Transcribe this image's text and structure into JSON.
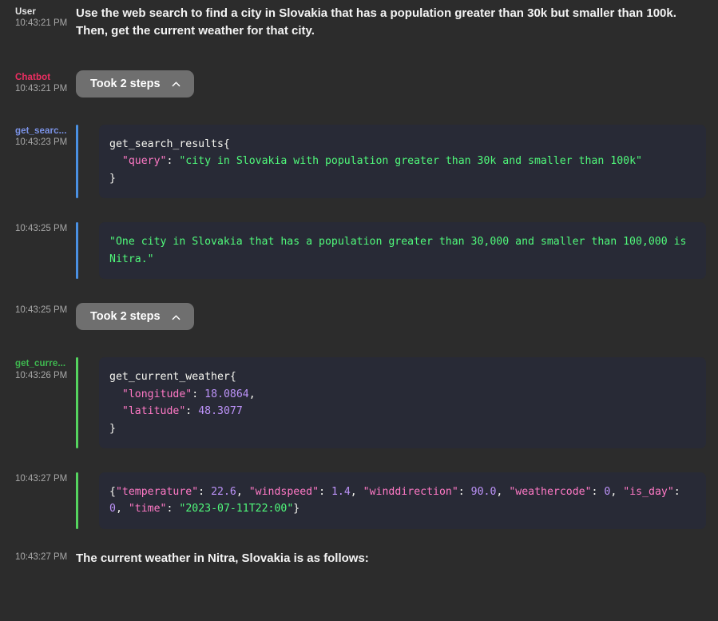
{
  "conversation": [
    {
      "id": "user-msg",
      "type": "text",
      "sender": "User",
      "timestamp": "10:43:21 PM",
      "text": "Use the web search to find a city in Slovakia that has a population greater than 30k but smaller than 100k. Then, get the current weather for that city."
    },
    {
      "id": "bot-steps-1",
      "type": "steps",
      "sender": "Chatbot",
      "timestamp": "10:43:21 PM",
      "label": "Took 2 steps",
      "chevron": "chevron-up-icon"
    },
    {
      "id": "tool-call-search",
      "type": "code",
      "tool_name": "get_searc...",
      "tool_name_full": "get_search_results",
      "timestamp": "10:43:23 PM",
      "accent": "blue",
      "accent_color": "#4a90e2",
      "name_color": "#7b93e8",
      "tokens": [
        {
          "t": "plain",
          "v": "get_search_results{"
        },
        {
          "t": "plain",
          "v": "\n  "
        },
        {
          "t": "key",
          "v": "\"query\""
        },
        {
          "t": "punc",
          "v": ": "
        },
        {
          "t": "str",
          "v": "\"city in Slovakia with population greater than 30k and smaller than 100k\""
        },
        {
          "t": "plain",
          "v": "\n}"
        }
      ]
    },
    {
      "id": "tool-result-search",
      "type": "code",
      "tool_name": "",
      "timestamp": "10:43:25 PM",
      "accent": "blue",
      "accent_color": "#4a90e2",
      "tokens": [
        {
          "t": "str",
          "v": "\"One city in Slovakia that has a population greater than 30,000 and smaller than 100,000 is Nitra.\""
        }
      ]
    },
    {
      "id": "bot-steps-2",
      "type": "steps",
      "sender": "",
      "timestamp": "10:43:25 PM",
      "label": "Took 2 steps",
      "chevron": "chevron-up-icon"
    },
    {
      "id": "tool-call-weather",
      "type": "code",
      "tool_name": "get_curre...",
      "tool_name_full": "get_current_weather",
      "timestamp": "10:43:26 PM",
      "accent": "green",
      "accent_color": "#55d45f",
      "name_color": "#3fb950",
      "tokens": [
        {
          "t": "plain",
          "v": "get_current_weather{"
        },
        {
          "t": "plain",
          "v": "\n  "
        },
        {
          "t": "key",
          "v": "\"longitude\""
        },
        {
          "t": "punc",
          "v": ": "
        },
        {
          "t": "num",
          "v": "18.0864"
        },
        {
          "t": "punc",
          "v": ","
        },
        {
          "t": "plain",
          "v": "\n  "
        },
        {
          "t": "key",
          "v": "\"latitude\""
        },
        {
          "t": "punc",
          "v": ": "
        },
        {
          "t": "num",
          "v": "48.3077"
        },
        {
          "t": "plain",
          "v": "\n}"
        }
      ]
    },
    {
      "id": "tool-result-weather",
      "type": "code",
      "tool_name": "",
      "timestamp": "10:43:27 PM",
      "accent": "green",
      "accent_color": "#55d45f",
      "tokens": [
        {
          "t": "punc",
          "v": "{"
        },
        {
          "t": "key",
          "v": "\"temperature\""
        },
        {
          "t": "punc",
          "v": ": "
        },
        {
          "t": "num",
          "v": "22.6"
        },
        {
          "t": "punc",
          "v": ", "
        },
        {
          "t": "key",
          "v": "\"windspeed\""
        },
        {
          "t": "punc",
          "v": ": "
        },
        {
          "t": "num",
          "v": "1.4"
        },
        {
          "t": "punc",
          "v": ", "
        },
        {
          "t": "key",
          "v": "\"winddirection\""
        },
        {
          "t": "punc",
          "v": ": "
        },
        {
          "t": "num",
          "v": "90.0"
        },
        {
          "t": "punc",
          "v": ", "
        },
        {
          "t": "key",
          "v": "\"weathercode\""
        },
        {
          "t": "punc",
          "v": ": "
        },
        {
          "t": "num",
          "v": "0"
        },
        {
          "t": "punc",
          "v": ", "
        },
        {
          "t": "key",
          "v": "\"is_day\""
        },
        {
          "t": "punc",
          "v": ": "
        },
        {
          "t": "num",
          "v": "0"
        },
        {
          "t": "punc",
          "v": ", "
        },
        {
          "t": "key",
          "v": "\"time\""
        },
        {
          "t": "punc",
          "v": ": "
        },
        {
          "t": "str",
          "v": "\"2023-07-11T22:00\""
        },
        {
          "t": "punc",
          "v": "}"
        }
      ]
    },
    {
      "id": "bot-final-msg",
      "type": "text",
      "sender": "",
      "timestamp": "10:43:27 PM",
      "text": "The current weather in Nitra, Slovakia is as follows:"
    }
  ],
  "theme": {
    "page_background": "#2c2c2c",
    "code_background": "#282a36",
    "pill_background": "#6f6f6f",
    "user_name_color": "#e6e6e6",
    "bot_name_color": "#ef2e62",
    "timestamp_color": "#a8a8a8",
    "string_token_color": "#50fa7b",
    "key_token_color": "#ff79c6",
    "number_token_color": "#bd93f9"
  }
}
